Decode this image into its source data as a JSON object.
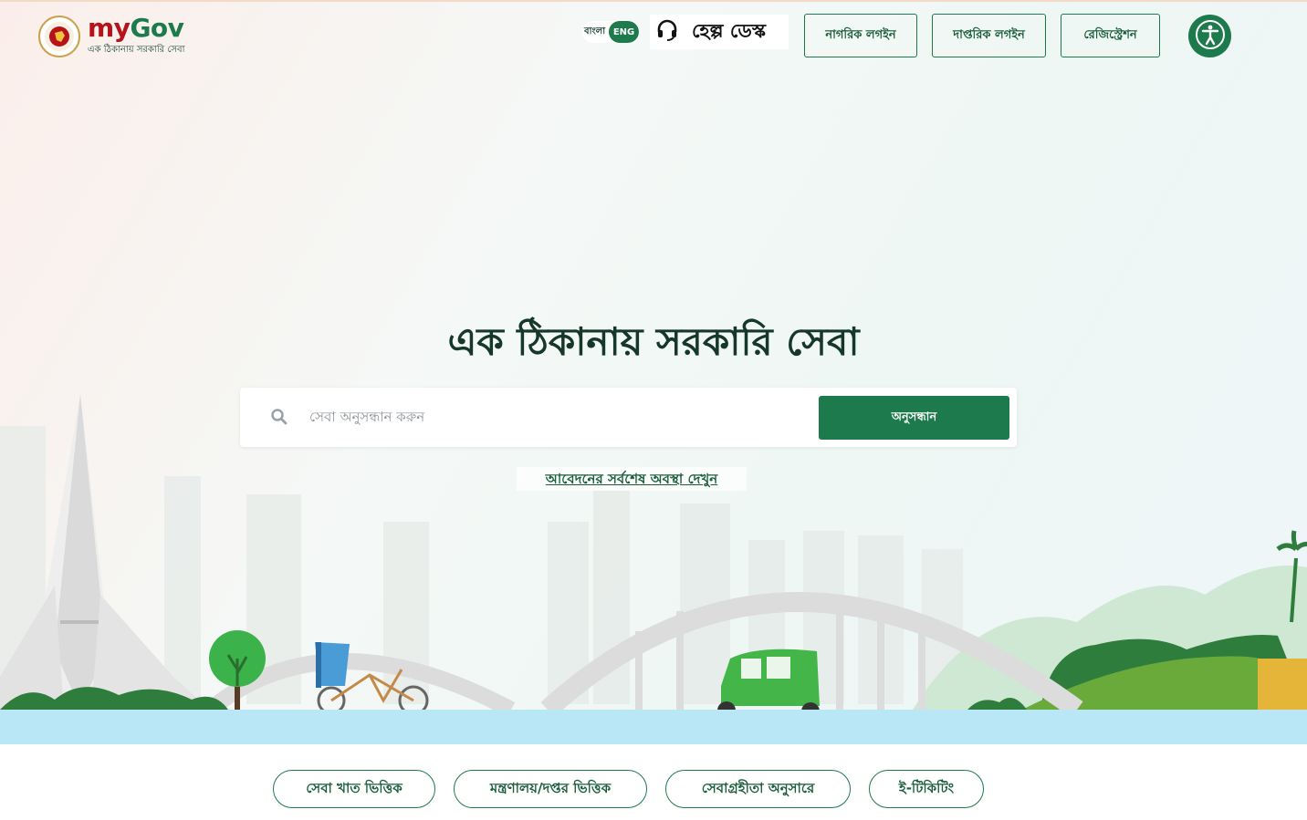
{
  "header": {
    "logo": {
      "brand_my": "my",
      "brand_gov": "Gov",
      "tagline": "এক ঠিকানায় সরকারি সেবা"
    },
    "language": {
      "bangla": "বাংলা",
      "english": "ENG",
      "active": "ENG"
    },
    "helpdesk": {
      "label": "হেল্প ডেস্ক",
      "icon": "headset-icon"
    },
    "buttons": {
      "citizen_login": "নাগরিক লগইন",
      "official_login": "দাপ্তরিক লগইন",
      "registration": "রেজিস্ট্রেশন"
    },
    "accessibility_icon": "accessibility-icon"
  },
  "hero": {
    "headline": "এক ঠিকানায় সরকারি সেবা",
    "search": {
      "placeholder": "সেবা অনুসন্ধান করুন",
      "value": "",
      "button_label": "অনুসন্ধান"
    },
    "status_link": "আবেদনের সর্বশেষ অবস্থা দেখুন"
  },
  "tabs": [
    {
      "label": "সেবা খাত ভিত্তিক"
    },
    {
      "label": "মন্ত্রণালয়/দপ্তর ভিত্তিক"
    },
    {
      "label": "সেবাগ্রহীতা অনুসারে"
    },
    {
      "label": "ই-টিকিটিং"
    }
  ],
  "colors": {
    "brand_green": "#1d7a4c",
    "brand_red": "#b5121b",
    "headline": "#16382b",
    "river": "#b9e7f5"
  }
}
